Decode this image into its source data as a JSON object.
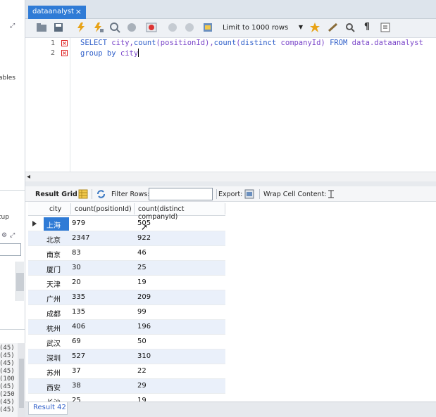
{
  "left_panel": {
    "label_tables": "ables",
    "label_startup": "tup",
    "log_lines": [
      "(45)",
      "(45)",
      "(45)",
      "(45)",
      "(100",
      "(45)",
      "(250",
      "(45)",
      "(45)",
      "(45)"
    ]
  },
  "tab": {
    "label": "dataanalyst",
    "close": "×"
  },
  "toolbar": {
    "limit_label": "Limit to 1000 rows"
  },
  "editor": {
    "lines": [
      {
        "num": "1",
        "tokens": [
          {
            "t": "SELECT ",
            "kw": true
          },
          {
            "t": "city,",
            "kw": false
          },
          {
            "t": "count",
            "kw": true
          },
          {
            "t": "(positionId),",
            "kw": false
          },
          {
            "t": "count",
            "kw": true
          },
          {
            "t": "(",
            "kw": false
          },
          {
            "t": "distinct ",
            "kw": true
          },
          {
            "t": "companyId) ",
            "kw": false
          },
          {
            "t": "FROM ",
            "kw": true
          },
          {
            "t": "data.dataanalyst",
            "kw": false
          }
        ]
      },
      {
        "num": "2",
        "tokens": [
          {
            "t": "group by ",
            "kw": true
          },
          {
            "t": "city",
            "kw": false
          }
        ]
      }
    ]
  },
  "result_toolbar": {
    "result_grid": "Result Grid",
    "filter_rows": "Filter Rows:",
    "export": "Export:",
    "wrap_cell": "Wrap Cell Content:"
  },
  "grid": {
    "columns": [
      "city",
      "count(positionId)",
      "count(distinct companyId)"
    ],
    "rows": [
      {
        "city": "上海",
        "a": "979",
        "b": "505"
      },
      {
        "city": "北京",
        "a": "2347",
        "b": "922"
      },
      {
        "city": "南京",
        "a": "83",
        "b": "46"
      },
      {
        "city": "厦门",
        "a": "30",
        "b": "25"
      },
      {
        "city": "天津",
        "a": "20",
        "b": "19"
      },
      {
        "city": "广州",
        "a": "335",
        "b": "209"
      },
      {
        "city": "成都",
        "a": "135",
        "b": "99"
      },
      {
        "city": "杭州",
        "a": "406",
        "b": "196"
      },
      {
        "city": "武汉",
        "a": "69",
        "b": "50"
      },
      {
        "city": "深圳",
        "a": "527",
        "b": "310"
      },
      {
        "city": "苏州",
        "a": "37",
        "b": "22"
      },
      {
        "city": "西安",
        "a": "38",
        "b": "29"
      },
      {
        "city": "长沙",
        "a": "25",
        "b": "19"
      }
    ]
  },
  "bottom_tab": {
    "label": "Result 42"
  },
  "colors": {
    "accent": "#2f7bd6",
    "keyword": "#2f5fc9",
    "identifier": "#7a46c9"
  }
}
